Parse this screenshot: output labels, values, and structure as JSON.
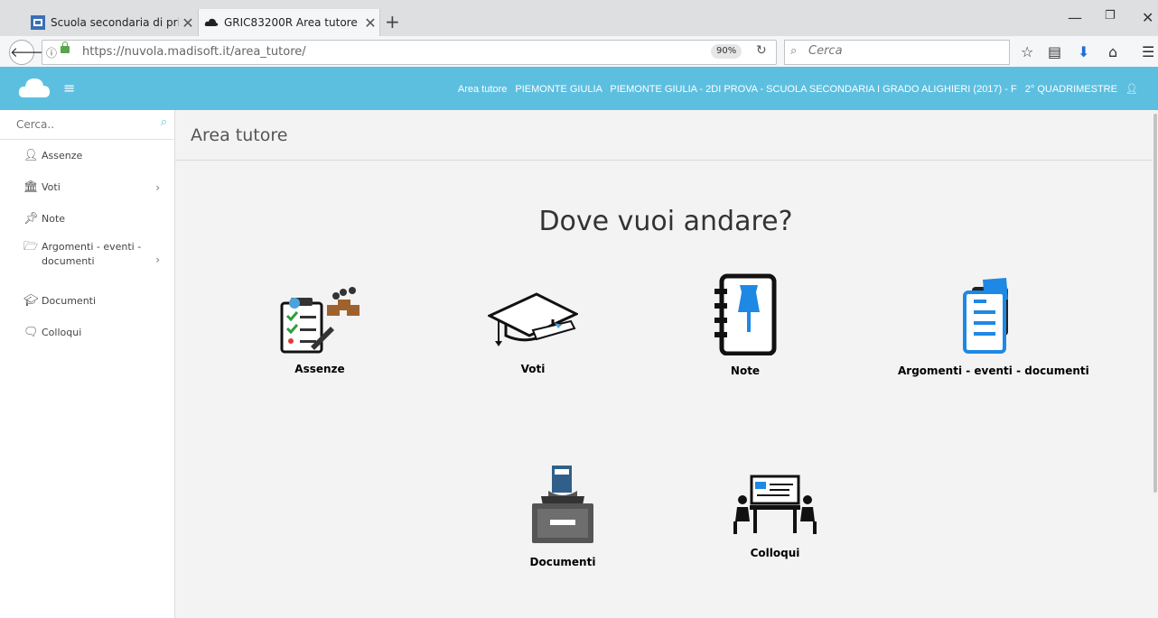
{
  "browser": {
    "tabs": [
      {
        "title": "Scuola secondaria di primo g",
        "favicon": "school-favicon"
      },
      {
        "title": "GRIC83200R Area tutore",
        "favicon": "cloud-favicon"
      }
    ],
    "url": "https://nuvola.madisoft.it/area_tutore/",
    "zoom": "90%",
    "search_placeholder": "Cerca"
  },
  "header": {
    "info": [
      "Area tutore",
      "PIEMONTE GIULIA",
      "PIEMONTE GIULIA - 2DI PROVA - SCUOLA SECONDARIA I GRADO ALIGHIERI (2017) - F",
      "2° QUADRIMESTRE"
    ]
  },
  "sidebar": {
    "search_placeholder": "Cerca..",
    "items": [
      {
        "label": "Assenze",
        "icon": "user-icon"
      },
      {
        "label": "Voti",
        "icon": "bank-icon",
        "has_submenu": true
      },
      {
        "label": "Note",
        "icon": "pushpin-icon"
      },
      {
        "label": "Argomenti - eventi - documenti",
        "icon": "folder-icon",
        "has_submenu": true
      },
      {
        "label": "Documenti",
        "icon": "graduation-cap-icon"
      },
      {
        "label": "Colloqui",
        "icon": "chat-icon"
      }
    ]
  },
  "main": {
    "title": "Area tutore",
    "headline": "Dove vuoi andare?",
    "tiles": [
      {
        "label": "Assenze",
        "icon": "attendance-icon"
      },
      {
        "label": "Voti",
        "icon": "graduation-cap-icon"
      },
      {
        "label": "Note",
        "icon": "notebook-pin-icon"
      },
      {
        "label": "Argomenti - eventi - documenti",
        "icon": "document-event-icon"
      },
      {
        "label": "Documenti",
        "icon": "archive-box-icon"
      },
      {
        "label": "Colloqui",
        "icon": "meeting-icon"
      }
    ]
  },
  "colors": {
    "accent": "#5dbfe0",
    "note_blue": "#1e88e5",
    "panel_bg": "#f3f3f3"
  }
}
